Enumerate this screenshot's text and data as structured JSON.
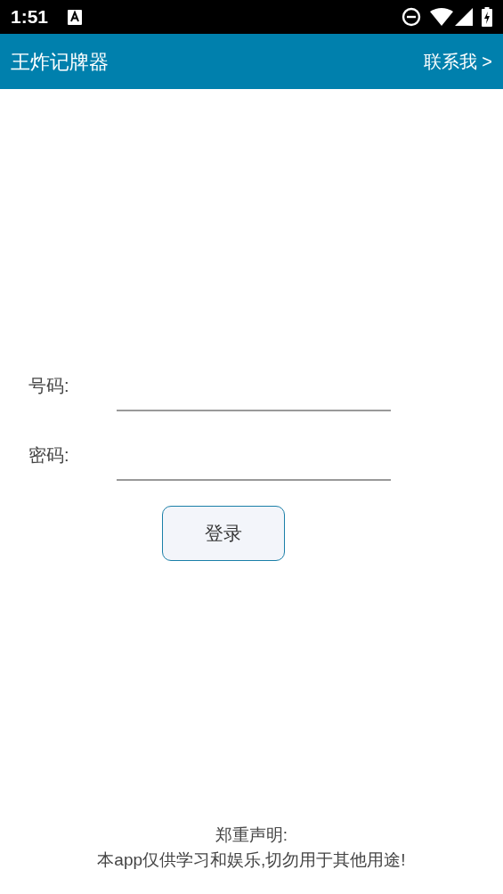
{
  "status_bar": {
    "time": "1:51"
  },
  "app_bar": {
    "title": "王炸记牌器",
    "action": "联系我 >"
  },
  "form": {
    "fields": [
      {
        "label": "号码:"
      },
      {
        "label": "密码:"
      }
    ],
    "button": "登录"
  },
  "footer": {
    "heading": "郑重声明:",
    "text": "本app仅供学习和娱乐,切勿用于其他用途!"
  }
}
